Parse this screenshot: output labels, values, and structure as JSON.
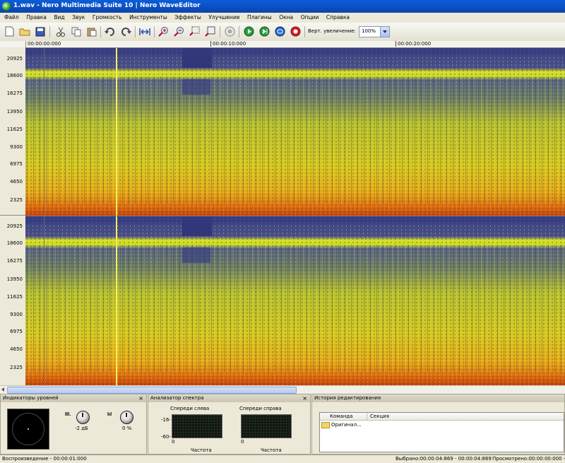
{
  "window": {
    "title": "1.wav - Nero Multimedia Suite 10  |  Nero WaveEditor"
  },
  "menu": [
    "Файл",
    "Правка",
    "Вид",
    "Звук",
    "Громкость",
    "Инструменты",
    "Эффекты",
    "Улучшение",
    "Плагины",
    "Окна",
    "Опции",
    "Справка"
  ],
  "toolbar": {
    "buttons": [
      "new-file-icon",
      "open-folder-icon",
      "save-icon",
      "cut-icon",
      "copy-icon",
      "paste-icon",
      "undo-icon",
      "redo-icon",
      "fit-selection-icon",
      "zoom-in-icon",
      "zoom-out-icon",
      "zoom-selection-icon",
      "zoom-all-icon",
      "record-stop-icon",
      "play-icon",
      "play-selection-icon",
      "loop-icon",
      "record-icon"
    ],
    "zoom_label": "Верт. увеличение:",
    "zoom_value": "100%"
  },
  "timeline": {
    "labels": [
      "00:00:00:000",
      "00:00:10:000",
      "00:00:20:000"
    ]
  },
  "channels": [
    {
      "ticks": [
        "20925",
        "18600",
        "16275",
        "13950",
        "11625",
        "9300",
        "6975",
        "4650",
        "2325"
      ]
    },
    {
      "ticks": [
        "20925",
        "18600",
        "16275",
        "13950",
        "11625",
        "9300",
        "6975",
        "4650",
        "2325"
      ]
    }
  ],
  "panels": {
    "levels": {
      "title": "Индикаторы уровней",
      "close": "×",
      "gain_value": "-2 дБ",
      "pan_value": "0 %"
    },
    "spectrum": {
      "title": "Анализатор спектра",
      "close": "×",
      "left_label": "Спереди слева",
      "right_label": "Спереди справа",
      "y_top": "-16-",
      "y_bottom": "-60-",
      "zero_left": "0",
      "zero_right": "0",
      "freq_left": "Частота",
      "freq_right": "Частота"
    },
    "history": {
      "title": "История редактирования",
      "col_command": "Команда",
      "col_section": "Секция",
      "rows": [
        {
          "command": "Оригинал..."
        }
      ]
    }
  },
  "status": {
    "playback": "Воспроизведение - 00:00:01:000",
    "selected": "Выбрано:00:00:04:869 - 00:00:04:869",
    "viewed": "Просмотрено:00:00:00:000 - 00:00:"
  },
  "colors": {
    "spectrogram_low": "#2a2f7a",
    "spectrogram_mid": "#c8d020",
    "spectrogram_high": "#e05010",
    "cursor": "#f4f060"
  }
}
